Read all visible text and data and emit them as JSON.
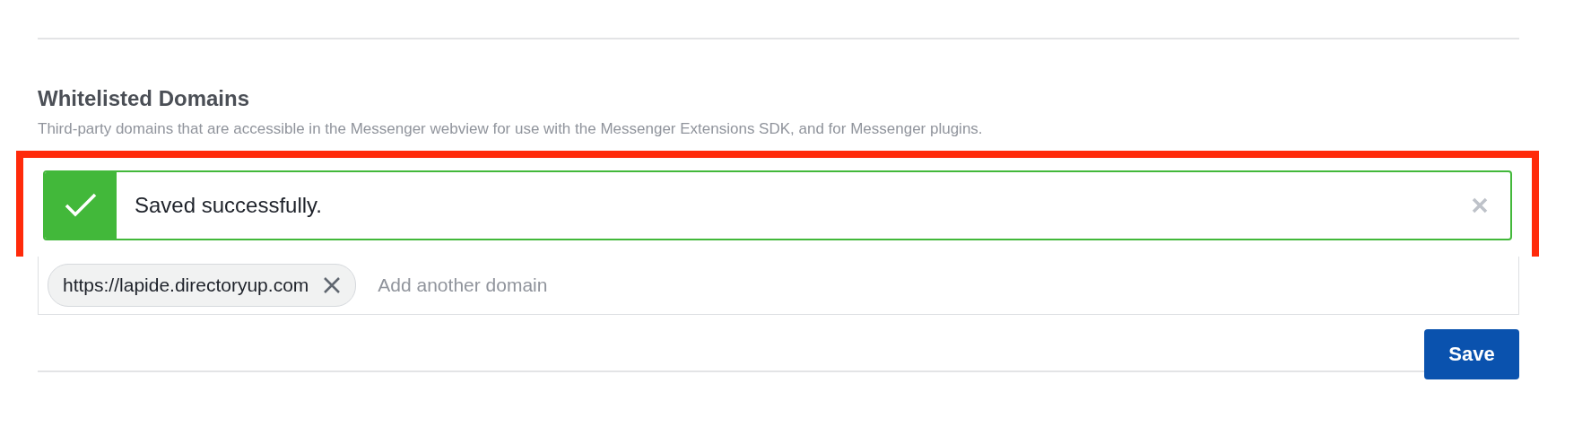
{
  "section": {
    "title": "Whitelisted Domains",
    "description": "Third-party domains that are accessible in the Messenger webview for use with the Messenger Extensions SDK, and for Messenger plugins."
  },
  "toast": {
    "kind": "success",
    "message": "Saved successfully.",
    "highlighted": true
  },
  "domains": {
    "tags": [
      {
        "label": "https://lapide.directoryup.com"
      }
    ],
    "placeholder": "Add another domain"
  },
  "buttons": [
    {
      "label": "Save"
    }
  ]
}
